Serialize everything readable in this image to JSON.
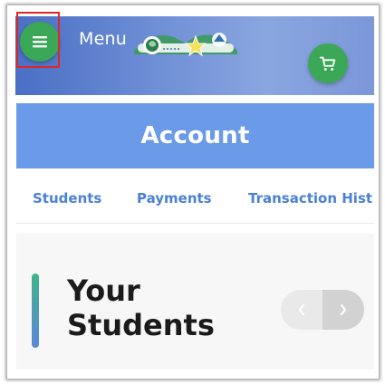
{
  "header": {
    "menu_label": "Menu",
    "logo_name": "school-logo",
    "menu_icon": "hamburger-icon",
    "cart_icon": "shopping-cart-icon"
  },
  "account": {
    "title": "Account"
  },
  "tabs": [
    {
      "label": "Students"
    },
    {
      "label": "Payments"
    },
    {
      "label": "Transaction Hist"
    }
  ],
  "section": {
    "title": "Your Students",
    "pager_prev_icon": "chevron-left-icon",
    "pager_next_icon": "chevron-right-icon"
  },
  "colors": {
    "accent_green": "#3aa856",
    "accent_blue": "#6a9ae8",
    "tab_blue": "#4a80d6",
    "highlight": "#e02626"
  }
}
